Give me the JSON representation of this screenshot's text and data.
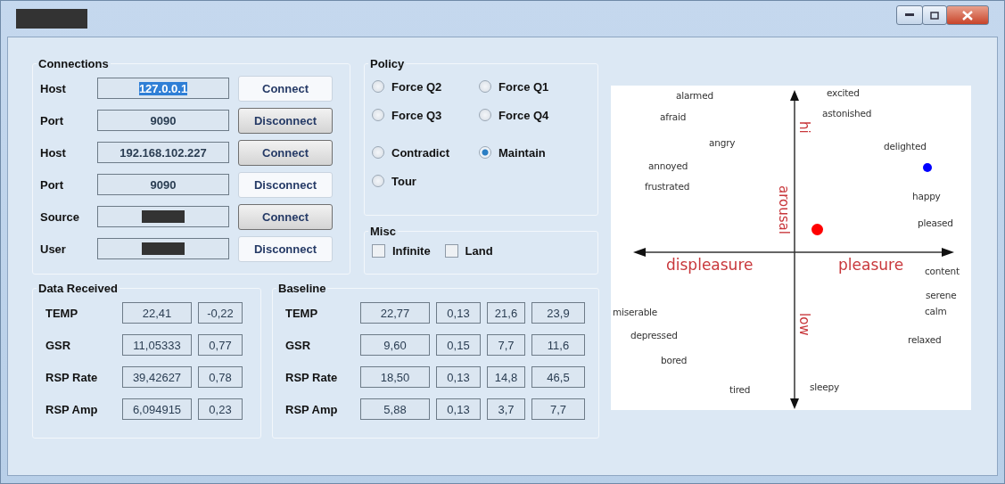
{
  "connections": {
    "title": "Connections",
    "rows": [
      {
        "label": "Host",
        "value": "127.0.0.1",
        "text_selected": true,
        "redacted": false,
        "button": "Connect",
        "pressed": false
      },
      {
        "label": "Port",
        "value": "9090",
        "text_selected": false,
        "redacted": false,
        "button": "Disconnect",
        "pressed": true
      },
      {
        "label": "Host",
        "value": "192.168.102.227",
        "text_selected": false,
        "redacted": false,
        "button": "Connect",
        "pressed": true
      },
      {
        "label": "Port",
        "value": "9090",
        "text_selected": false,
        "redacted": false,
        "button": "Disconnect",
        "pressed": false
      },
      {
        "label": "Source",
        "redacted": true,
        "button": "Connect",
        "pressed": true
      },
      {
        "label": "User",
        "redacted": true,
        "button": "Disconnect",
        "pressed": false
      }
    ]
  },
  "policy": {
    "title": "Policy",
    "options": [
      {
        "label": "Force Q2",
        "selected": false
      },
      {
        "label": "Force Q1",
        "selected": false
      },
      {
        "label": "Force Q3",
        "selected": false
      },
      {
        "label": "Force Q4",
        "selected": false
      },
      {
        "label": "Contradict",
        "selected": false
      },
      {
        "label": "Maintain",
        "selected": true
      },
      {
        "label": "Tour",
        "selected": false
      }
    ]
  },
  "misc": {
    "title": "Misc",
    "options": [
      {
        "label": "Infinite",
        "checked": false
      },
      {
        "label": "Land",
        "checked": false
      }
    ]
  },
  "data_received": {
    "title": "Data Received",
    "rows": [
      {
        "label": "TEMP",
        "values": [
          "22,41",
          "-0,22"
        ]
      },
      {
        "label": "GSR",
        "values": [
          "11,05333",
          "0,77"
        ]
      },
      {
        "label": "RSP Rate",
        "values": [
          "39,42627",
          "0,78"
        ]
      },
      {
        "label": "RSP Amp",
        "values": [
          "6,094915",
          "0,23"
        ]
      }
    ]
  },
  "baseline": {
    "title": "Baseline",
    "rows": [
      {
        "label": "TEMP",
        "values": [
          "22,77",
          "0,13",
          "21,6",
          "23,9"
        ]
      },
      {
        "label": "GSR",
        "values": [
          "9,60",
          "0,15",
          "7,7",
          "11,6"
        ]
      },
      {
        "label": "RSP Rate",
        "values": [
          "18,50",
          "0,13",
          "14,8",
          "46,5"
        ]
      },
      {
        "label": "RSP Amp",
        "values": [
          "5,88",
          "0,13",
          "3,7",
          "7,7"
        ]
      }
    ]
  },
  "circumplex": {
    "axis_labels": {
      "high": "hi",
      "vertical": "arousal",
      "low": "low",
      "left": "displeasure",
      "right": "pleasure"
    },
    "words": [
      "excited",
      "alarmed",
      "astonished",
      "afraid",
      "angry",
      "delighted",
      "annoyed",
      "frustrated",
      "happy",
      "pleased",
      "content",
      "serene",
      "calm",
      "miserable",
      "depressed",
      "relaxed",
      "bored",
      "sleepy",
      "tired"
    ],
    "markers": [
      {
        "color": "#ff0000"
      },
      {
        "color": "#0000ff"
      }
    ]
  }
}
